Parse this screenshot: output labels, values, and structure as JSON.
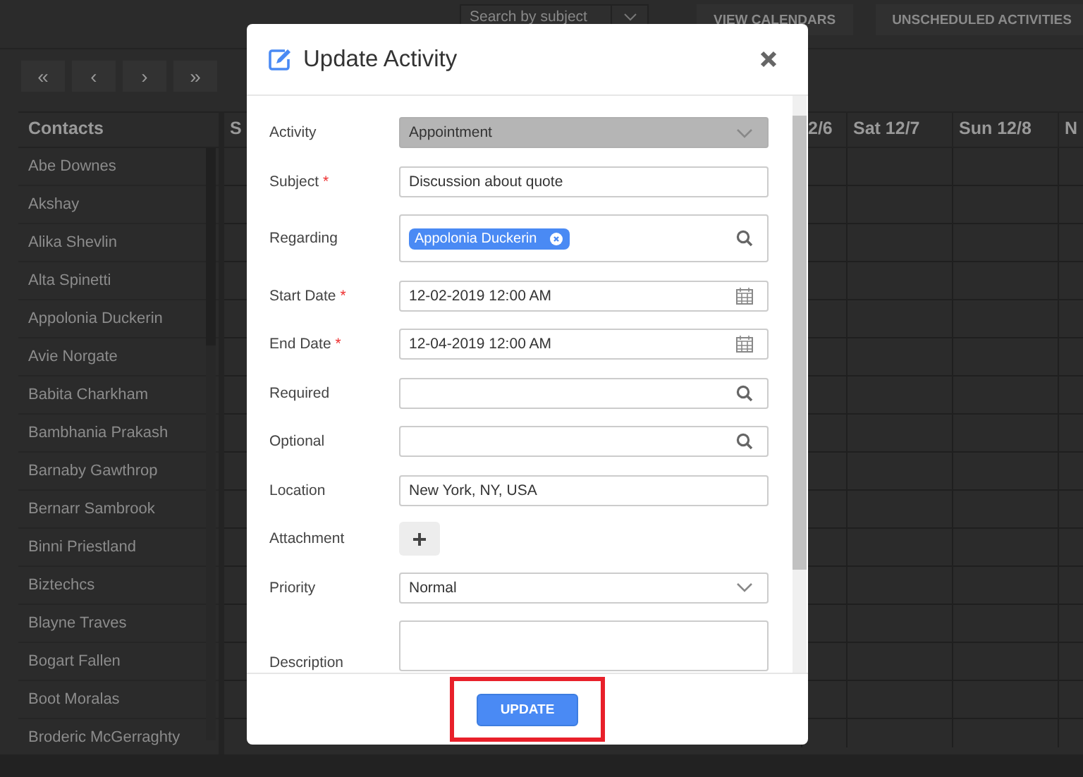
{
  "toolbar": {
    "search": {
      "placeholder": "Search by subject"
    },
    "buttons": [
      "VIEW CALENDARS",
      "UNSCHEDULED ACTIVITIES"
    ]
  },
  "nav_buttons": [
    "«",
    "‹",
    "›",
    "»"
  ],
  "contacts": {
    "header": "Contacts",
    "rows": [
      "Abe Downes",
      "Akshay",
      "Alika Shevlin",
      "Alta Spinetti",
      "Appolonia Duckerin",
      "Avie Norgate",
      "Babita Charkham",
      "Bambhania Prakash",
      "Barnaby Gawthrop",
      "Bernarr Sambrook",
      "Binni Priestland",
      "Biztechcs",
      "Blayne Traves",
      "Bogart Fallen",
      "Boot Moralas",
      "Broderic McGerraghty"
    ]
  },
  "calendar": {
    "columns": [
      "S",
      "2/6",
      "Sat 12/7",
      "Sun 12/8",
      "N"
    ]
  },
  "dialog": {
    "title": "Update Activity",
    "required_marker": "*",
    "fields": [
      {
        "kind": "select",
        "label": "Activity",
        "required": false,
        "disabled": true,
        "value": "Appointment"
      },
      {
        "kind": "text",
        "label": "Subject",
        "required": true,
        "value": "Discussion about quote"
      },
      {
        "kind": "tags",
        "label": "Regarding",
        "required": false,
        "tags": [
          "Appolonia Duckerin"
        ]
      },
      {
        "kind": "date",
        "label": "Start Date",
        "required": true,
        "value": "12-02-2019 12:00 AM"
      },
      {
        "kind": "date",
        "label": "End Date",
        "required": true,
        "value": "12-04-2019 12:00 AM"
      },
      {
        "kind": "lookup",
        "label": "Required",
        "required": false
      },
      {
        "kind": "lookup",
        "label": "Optional",
        "required": false
      },
      {
        "kind": "text",
        "label": "Location",
        "required": false,
        "value": "New York, NY, USA"
      },
      {
        "kind": "attachment",
        "label": "Attachment",
        "required": false
      },
      {
        "kind": "select",
        "label": "Priority",
        "required": false,
        "disabled": false,
        "value": "Normal"
      },
      {
        "kind": "textarea",
        "label": "Description",
        "required": false
      }
    ],
    "button": "UPDATE"
  }
}
